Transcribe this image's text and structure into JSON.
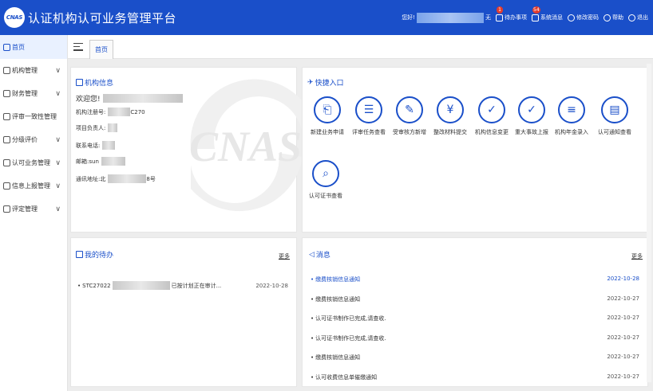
{
  "header": {
    "logo_text": "CNAS",
    "title": "认证机构认可业务管理平台",
    "greeting": "您好!",
    "greeting_suffix": "无",
    "items": [
      {
        "label": "待办事项",
        "badge": "1"
      },
      {
        "label": "系统消息",
        "badge": "54"
      },
      {
        "label": "修改密码",
        "badge": ""
      },
      {
        "label": "帮助",
        "badge": ""
      },
      {
        "label": "退出",
        "badge": ""
      }
    ]
  },
  "sidebar": {
    "items": [
      {
        "label": "首页",
        "has_children": false
      },
      {
        "label": "机构管理",
        "has_children": true
      },
      {
        "label": "财务管理",
        "has_children": true
      },
      {
        "label": "评审一致性管理",
        "has_children": false
      },
      {
        "label": "分级评价",
        "has_children": true
      },
      {
        "label": "认可业务管理",
        "has_children": true
      },
      {
        "label": "信息上报管理",
        "has_children": true
      },
      {
        "label": "评定管理",
        "has_children": true
      }
    ]
  },
  "tabs": [
    {
      "label": "首页"
    }
  ],
  "org_info": {
    "title": "机构信息",
    "welcome": "欢迎您!",
    "watermark": "CNAS",
    "fields": [
      {
        "label": "机构注册号:",
        "value": "C270"
      },
      {
        "label": "项目负责人:",
        "value": ""
      },
      {
        "label": "联系电话:",
        "value": ""
      },
      {
        "label": "邮箱:",
        "value": "sun"
      },
      {
        "label": "通讯地址:",
        "value": "北",
        "tail": "8号"
      }
    ]
  },
  "quick_links": {
    "title": "快捷入口",
    "items": [
      {
        "label": "新建业务申请",
        "icon": "document-new-icon"
      },
      {
        "label": "评审任务查看",
        "icon": "document-list-icon"
      },
      {
        "label": "受审核方新增",
        "icon": "edit-icon"
      },
      {
        "label": "整改材料提交",
        "icon": "payment-icon"
      },
      {
        "label": "机构信息变更",
        "icon": "shield-check-icon"
      },
      {
        "label": "重大事故上报",
        "icon": "shield-check-icon"
      },
      {
        "label": "机构年金录入",
        "icon": "notebook-icon"
      },
      {
        "label": "认可通知查看",
        "icon": "clipboard-icon"
      },
      {
        "label": "认可证书查看",
        "icon": "search-document-icon"
      }
    ]
  },
  "todo": {
    "title": "我的待办",
    "more": "更多",
    "items": [
      {
        "text_prefix": "STC27022",
        "text_suffix": "已按计划正在审计...",
        "date": "2022-10-28"
      }
    ]
  },
  "messages": {
    "title": "消息",
    "more": "更多",
    "items": [
      {
        "text": "缴费核销信息通知",
        "date": "2022-10-28"
      },
      {
        "text": "缴费核销信息通知",
        "date": "2022-10-27"
      },
      {
        "text": "认可证书制作已完成,请查收.",
        "date": "2022-10-27"
      },
      {
        "text": "认可证书制作已完成,请查收.",
        "date": "2022-10-27"
      },
      {
        "text": "缴费核销信息通知",
        "date": "2022-10-27"
      },
      {
        "text": "认可收费信息单催缴通知",
        "date": "2022-10-27"
      }
    ]
  },
  "colors": {
    "primary": "#1a4fc9",
    "badge": "#e23b2d",
    "background": "#ededed"
  }
}
